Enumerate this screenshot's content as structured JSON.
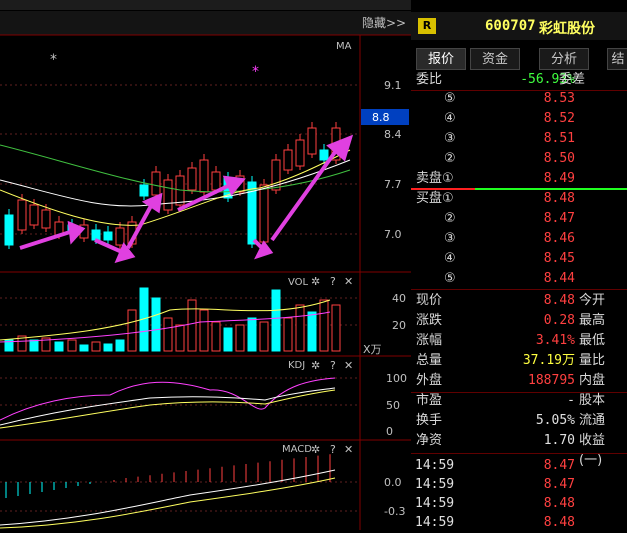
{
  "top": {
    "hide_label": "隐藏>>",
    "badge": "R",
    "code": "600707",
    "name": "彩虹股份"
  },
  "tabs": [
    {
      "label": "报价"
    },
    {
      "label": "资金"
    },
    {
      "label": "分析"
    },
    {
      "label": "结"
    }
  ],
  "weibi": {
    "label": "委比",
    "value": "-56.93%",
    "label2": "委差"
  },
  "sell": [
    {
      "n": "⑤",
      "price": "8.53"
    },
    {
      "n": "④",
      "price": "8.52"
    },
    {
      "n": "③",
      "price": "8.51"
    },
    {
      "n": "②",
      "price": "8.50"
    },
    {
      "n": "卖盘①",
      "price": "8.49"
    }
  ],
  "buy": [
    {
      "n": "买盘①",
      "price": "8.48"
    },
    {
      "n": "②",
      "price": "8.47"
    },
    {
      "n": "③",
      "price": "8.46"
    },
    {
      "n": "④",
      "price": "8.45"
    },
    {
      "n": "⑤",
      "price": "8.44"
    }
  ],
  "stats": [
    {
      "l": "现价",
      "v": "8.48",
      "l2": "今开",
      "c": "red"
    },
    {
      "l": "涨跌",
      "v": "0.28",
      "l2": "最高",
      "c": "red"
    },
    {
      "l": "涨幅",
      "v": "3.41%",
      "l2": "最低",
      "c": "red"
    },
    {
      "l": "总量",
      "v": "37.19万",
      "l2": "量比",
      "c": "yellow"
    },
    {
      "l": "外盘",
      "v": "188795",
      "l2": "内盘",
      "c": "red"
    }
  ],
  "stats2": [
    {
      "l": "市盈",
      "v": "-",
      "l2": "股本"
    },
    {
      "l": "换手",
      "v": "5.05%",
      "l2": "流通"
    },
    {
      "l": "净资",
      "v": "1.70",
      "l2": "收益(一)"
    }
  ],
  "ticks": [
    {
      "t": "14:59",
      "p": "8.47"
    },
    {
      "t": "14:59",
      "p": "8.47"
    },
    {
      "t": "14:59",
      "p": "8.48"
    },
    {
      "t": "14:59",
      "p": "8.48"
    }
  ],
  "main_chart": {
    "label": "MA",
    "price_ticks": [
      "9.1",
      "8.4",
      "7.7",
      "7.0"
    ],
    "current_price": "8.8",
    "star": "*"
  },
  "vol_panel": {
    "label": "VOL",
    "ticks": [
      "40",
      "20"
    ],
    "unit": "X万"
  },
  "kdj_panel": {
    "label": "KDJ",
    "ticks": [
      "100",
      "50",
      "0"
    ]
  },
  "macd_panel": {
    "label": "MACD",
    "ticks": [
      "0.0",
      "-0.3"
    ]
  },
  "panel_icons": {
    "gear": "✲",
    "help": "?",
    "close": "✕"
  },
  "colors": {
    "up": "#ff4040",
    "down": "#00ffff",
    "arrow": "#e040e0",
    "ma_yellow": "#ffff60",
    "ma_green": "#40c040",
    "ma_white": "#ffffff",
    "ma_magenta": "#ff40ff"
  }
}
